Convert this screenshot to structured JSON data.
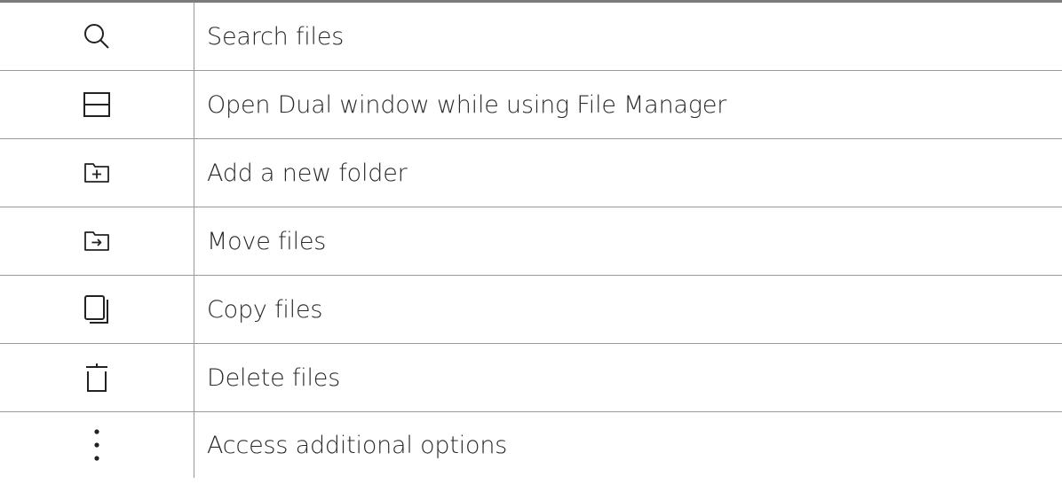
{
  "rows": [
    {
      "icon": "search-icon",
      "label": "Search files"
    },
    {
      "icon": "dual-window-icon",
      "label": "Open Dual window while using File Manager"
    },
    {
      "icon": "add-folder-icon",
      "label": "Add a new folder"
    },
    {
      "icon": "move-folder-icon",
      "label": "Move files"
    },
    {
      "icon": "copy-icon",
      "label": "Copy files"
    },
    {
      "icon": "delete-icon",
      "label": "Delete files"
    },
    {
      "icon": "more-options-icon",
      "label": "Access additional options"
    }
  ]
}
